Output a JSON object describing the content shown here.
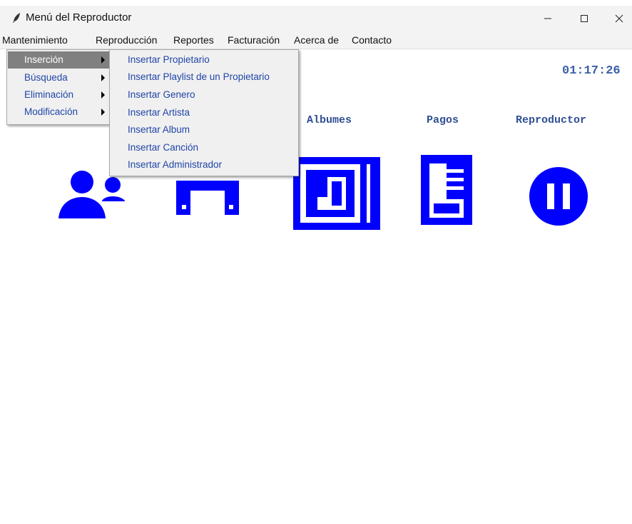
{
  "window": {
    "title": "Menú del Reproductor",
    "minimize_icon": "minimize-icon",
    "maximize_icon": "maximize-icon",
    "close_icon": "close-icon"
  },
  "menubar": {
    "items": [
      "Mantenimiento",
      "Reproducción",
      "Reportes",
      "Facturación",
      "Acerca de",
      "Contacto"
    ]
  },
  "mantenimiento_menu": {
    "items": [
      "Inserción",
      "Búsqueda",
      "Eliminación",
      "Modificación"
    ],
    "active": "Inserción"
  },
  "insercion_submenu": {
    "items": [
      "Insertar Propietario",
      "Insertar Playlist de un Propietario",
      "Insertar Genero",
      "Insertar Artista",
      "Insertar Album",
      "Insertar Canción",
      "Insertar Administrador"
    ]
  },
  "clock": "01:17:26",
  "sections": {
    "albumes": "Albumes",
    "pagos": "Pagos",
    "reproductor": "Reproductor"
  },
  "icons": {
    "users": "users-icon",
    "music": "music-note-icon",
    "album": "album-icon",
    "payment": "payment-document-icon",
    "pause": "pause-icon"
  },
  "colors": {
    "icon_blue": "#0000ff",
    "text_blue": "#2e4f93",
    "menu_highlight": "#808080"
  }
}
